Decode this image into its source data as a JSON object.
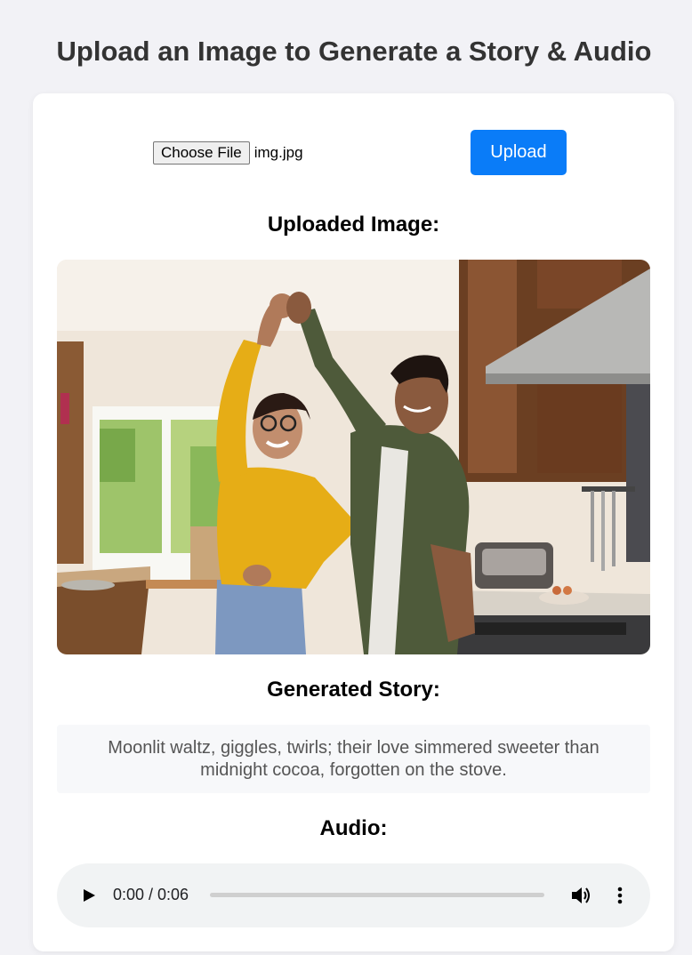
{
  "page": {
    "title": "Upload an Image to Generate a Story & Audio"
  },
  "upload": {
    "choose_file_label": "Choose File",
    "file_name": "img.jpg",
    "upload_label": "Upload",
    "accent_color": "#0a7cf8"
  },
  "image_section": {
    "heading": "Uploaded Image:"
  },
  "story_section": {
    "heading": "Generated Story:",
    "text": "Moonlit waltz, giggles, twirls; their love simmered sweeter than midnight cocoa, forgotten on the stove."
  },
  "audio_section": {
    "heading": "Audio:",
    "time": "0:00 / 0:06",
    "progress": 0,
    "icons": [
      "play-icon",
      "volume-icon",
      "more-options-icon"
    ]
  }
}
